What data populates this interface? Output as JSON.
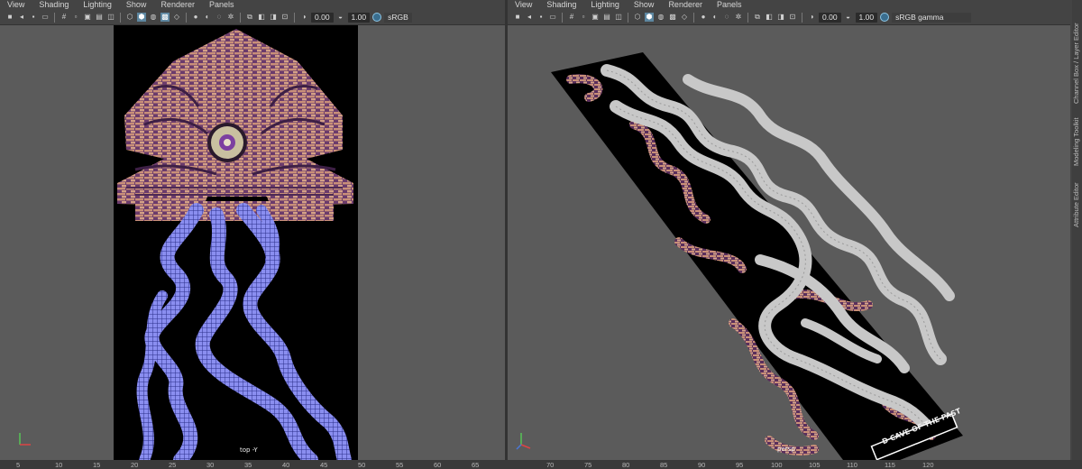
{
  "left_panel": {
    "menu": [
      "View",
      "Shading",
      "Lighting",
      "Show",
      "Renderer",
      "Panels"
    ],
    "exposure": "0.00",
    "gamma": "1.00",
    "color_space": "sRGB",
    "camera": "top -Y"
  },
  "right_panel": {
    "menu": [
      "View",
      "Shading",
      "Lighting",
      "Show",
      "Renderer",
      "Panels"
    ],
    "exposure": "0.00",
    "gamma": "1.00",
    "color_space": "sRGB gamma",
    "camera": "persp",
    "sign_text": "D CAVE OF THE PAST"
  },
  "side_tabs": [
    "Channel Box / Layer Editor",
    "Modeling Toolkit",
    "Attribute Editor"
  ],
  "timeline": {
    "ticks": [
      "5",
      "10",
      "15",
      "20",
      "25",
      "30",
      "35",
      "40",
      "45",
      "50",
      "55",
      "60",
      "65",
      "70",
      "75",
      "80",
      "85",
      "90",
      "95",
      "100",
      "105",
      "110",
      "115",
      "120"
    ]
  },
  "colors": {
    "viewport_bg": "#5b5b5b",
    "map_bg": "#000000",
    "brick": "#c98f78",
    "purple": "#6b3b6c",
    "wireframe": "#6f73d6",
    "pipe": "#c8c8c8",
    "accent": "#5d87a1"
  },
  "icons": {
    "toolbar": [
      "camera-icon",
      "bookmark-icon",
      "image-plane-icon",
      "grid-icon",
      "film-gate-icon",
      "resolution-gate-icon",
      "gate-mask-icon",
      "field-chart-icon",
      "safe-action-icon",
      "safe-title-icon",
      "wireframe-icon",
      "smooth-shade-icon",
      "default-material-icon",
      "textured-icon",
      "use-lights-icon",
      "shadows-icon",
      "ambient-occlusion-icon",
      "motion-blur-icon",
      "anti-alias-icon",
      "depth-of-field-icon",
      "isolate-select-icon",
      "xray-icon",
      "xray-joints-icon",
      "xray-active-icon",
      "backface-icon",
      "exposure-icon",
      "gamma-icon",
      "color-management-icon"
    ]
  }
}
